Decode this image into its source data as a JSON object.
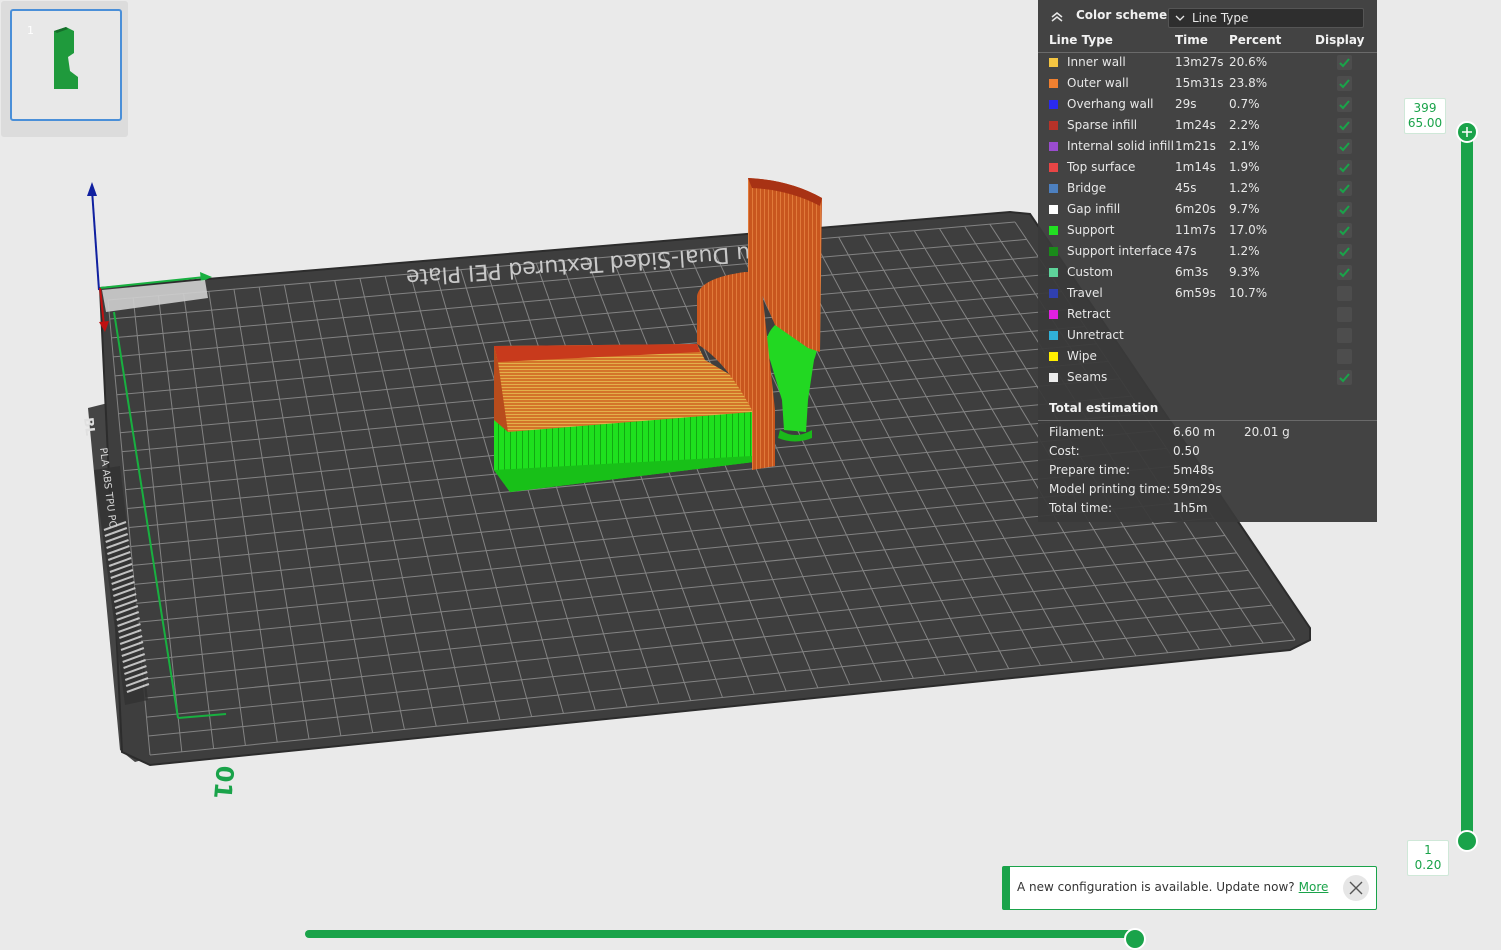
{
  "thumbnail": {
    "plate_number": "1"
  },
  "plate": {
    "label": "Bambu Dual-Sided Textured PEI Plate",
    "side_label": "PLA ABS TPU PC",
    "logo_text": "BL",
    "corner_number": "01"
  },
  "legend": {
    "title": "Color scheme",
    "scheme_value": "Line Type",
    "columns": {
      "line_type": "Line Type",
      "time": "Time",
      "percent": "Percent",
      "display": "Display"
    },
    "rows": [
      {
        "name": "Inner wall",
        "time": "13m27s",
        "percent": "20.6%",
        "color": "#f4c542",
        "display": true
      },
      {
        "name": "Outer wall",
        "time": "15m31s",
        "percent": "23.8%",
        "color": "#f08030",
        "display": true
      },
      {
        "name": "Overhang wall",
        "time": "29s",
        "percent": "0.7%",
        "color": "#2a2af0",
        "display": true
      },
      {
        "name": "Sparse infill",
        "time": "1m24s",
        "percent": "2.2%",
        "color": "#b83228",
        "display": true
      },
      {
        "name": "Internal solid infill",
        "time": "1m21s",
        "percent": "2.1%",
        "color": "#9a4ccf",
        "display": true
      },
      {
        "name": "Top surface",
        "time": "1m14s",
        "percent": "1.9%",
        "color": "#e84545",
        "display": true
      },
      {
        "name": "Bridge",
        "time": "45s",
        "percent": "1.2%",
        "color": "#4d80c0",
        "display": true
      },
      {
        "name": "Gap infill",
        "time": "6m20s",
        "percent": "9.7%",
        "color": "#ffffff",
        "display": true
      },
      {
        "name": "Support",
        "time": "11m7s",
        "percent": "17.0%",
        "color": "#22e022",
        "display": true
      },
      {
        "name": "Support interface",
        "time": "47s",
        "percent": "1.2%",
        "color": "#1a8a1a",
        "display": true
      },
      {
        "name": "Custom",
        "time": "6m3s",
        "percent": "9.3%",
        "color": "#5ed39a",
        "display": true
      },
      {
        "name": "Travel",
        "time": "6m59s",
        "percent": "10.7%",
        "color": "#3040b0",
        "display": false
      },
      {
        "name": "Retract",
        "time": "",
        "percent": "",
        "color": "#e020e0",
        "display": false
      },
      {
        "name": "Unretract",
        "time": "",
        "percent": "",
        "color": "#30b0d8",
        "display": false
      },
      {
        "name": "Wipe",
        "time": "",
        "percent": "",
        "color": "#ffee00",
        "display": false
      },
      {
        "name": "Seams",
        "time": "",
        "percent": "",
        "color": "#ececec",
        "display": true
      }
    ],
    "total_title": "Total estimation",
    "estimation": [
      {
        "label": "Filament:",
        "value": "6.60 m",
        "value2": "20.01 g"
      },
      {
        "label": "Cost:",
        "value": "0.50",
        "value2": ""
      },
      {
        "label": "Prepare time:",
        "value": "5m48s",
        "value2": ""
      },
      {
        "label": "Model printing time:",
        "value": "59m29s",
        "value2": ""
      },
      {
        "label": "Total time:",
        "value": "1h5m",
        "value2": ""
      }
    ]
  },
  "layer_slider": {
    "top_layer": "399",
    "top_height": "65.00",
    "bottom_layer": "1",
    "bottom_height": "0.20",
    "accent": "#1aa34a"
  },
  "notification": {
    "text": "A new configuration is available. Update now?",
    "link": "More"
  }
}
